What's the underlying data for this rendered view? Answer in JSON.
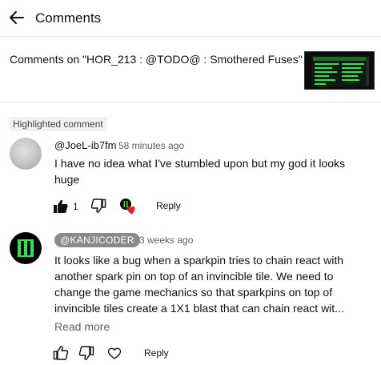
{
  "header": {
    "title": "Comments"
  },
  "video": {
    "title": "Comments on \"HOR_213 : @TODO@ : Smothered Fuses\""
  },
  "highlighted_label": "Highlighted comment",
  "comments": [
    {
      "author": "@JoeL-ib7fm",
      "time": "58 minutes ago",
      "lines": [
        "I have no idea what I've stumbled upon but my god it looks",
        "huge"
      ],
      "likes": "1",
      "reply_label": "Reply"
    },
    {
      "author": "@KANJICODER",
      "time": "3 weeks ago",
      "lines": [
        "It looks like a bug when a sparkpin tries to chain react with",
        "another spark pin on top of an invincible tile. We need to",
        "change the game mechanics so that sparkpins on top of",
        "invincible tiles create a 1X1 blast that can chain react wit..."
      ],
      "read_more": "Read more",
      "reply_label": "Reply"
    }
  ],
  "colors": {
    "heart": "#e0201e",
    "accent_green": "#2ee05a"
  },
  "icons": [
    "back-arrow-icon",
    "thumbs-up-icon",
    "thumbs-down-icon",
    "heart-icon",
    "creator-heart-icon"
  ]
}
